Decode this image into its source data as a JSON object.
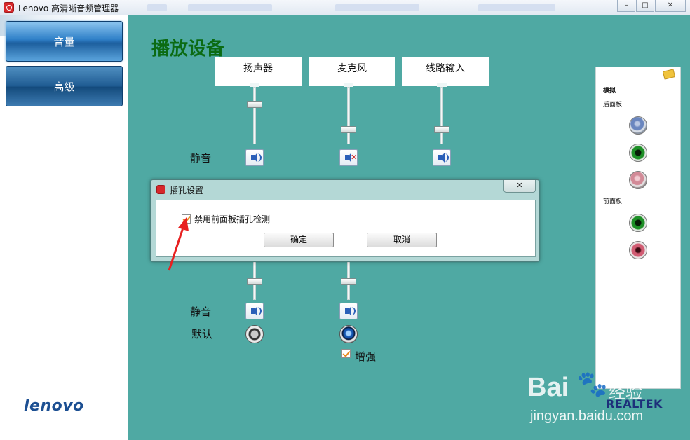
{
  "window": {
    "title": "Lenovo 高清晰音频管理器"
  },
  "sidebar": {
    "items": [
      {
        "label": "音量",
        "active": true
      },
      {
        "label": "高级",
        "active": false
      }
    ],
    "logo": "lenovo"
  },
  "main": {
    "title": "播放设备",
    "devices": [
      {
        "label": "扬声器",
        "muted": false
      },
      {
        "label": "麦克风",
        "muted": true
      },
      {
        "label": "线路输入",
        "muted": false
      }
    ],
    "mute_label": "静音",
    "lower_mute_label": "静音",
    "default_label": "默认",
    "enhance_label": "增强",
    "enhance_checked": true
  },
  "connector_panel": {
    "analog_label": "模拟",
    "rear_label": "后面板",
    "front_label": "前面板",
    "rear_jacks": [
      "blue",
      "green",
      "pink"
    ],
    "front_jacks": [
      "green",
      "pink"
    ],
    "brand": "REALTEK"
  },
  "dialog": {
    "title": "插孔设置",
    "checkbox_label": "禁用前面板插孔检测",
    "checkbox_checked": true,
    "ok_label": "确定",
    "cancel_label": "取消",
    "close_glyph": "✕"
  },
  "watermark": {
    "bai": "Bai",
    "jingyan": "经验",
    "url": "jingyan.baidu.com"
  },
  "colors": {
    "background": "#4fa9a3",
    "title_green": "#0b6b13",
    "accent_blue": "#2f80c8",
    "check_orange": "#e8891c"
  }
}
